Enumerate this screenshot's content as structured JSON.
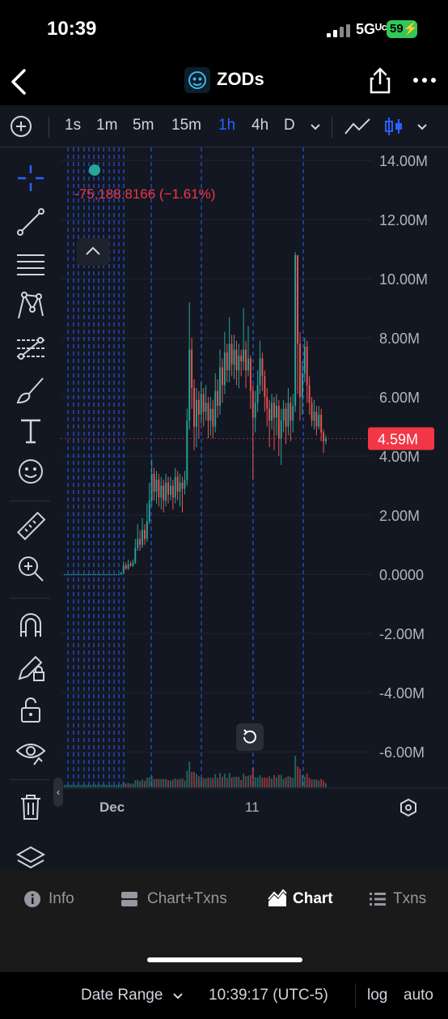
{
  "status": {
    "time": "10:39",
    "network": "5Gᵁᶜ",
    "battery": "59"
  },
  "header": {
    "token_name": "ZODs"
  },
  "toolbar": {
    "timeframes": [
      "1s",
      "1m",
      "5m",
      "15m",
      "1h",
      "4h",
      "D"
    ],
    "active_timeframe": "1h"
  },
  "chart": {
    "pnl_label": "-75,188.8166 (−1.61%)",
    "current_price_label": "4.59M",
    "y_ticks": [
      "14.00M",
      "12.00M",
      "10.00M",
      "8.00M",
      "6.00M",
      "4.00M",
      "2.00M",
      "0.0000",
      "-2.00M",
      "-4.00M",
      "-6.00M"
    ],
    "x_labels": [
      "Dec",
      "11"
    ]
  },
  "bottom_bar": {
    "date_range": "Date Range",
    "time": "10:39:17 (UTC-5)",
    "log": "log",
    "auto": "auto"
  },
  "tabs": [
    {
      "label": "Info",
      "icon": "info-icon"
    },
    {
      "label": "Chart+Txns",
      "icon": "chart-txns-icon"
    },
    {
      "label": "Chart",
      "icon": "chart-icon"
    },
    {
      "label": "Txns",
      "icon": "list-icon"
    }
  ],
  "active_tab": "Chart",
  "colors": {
    "up": "#26a69a",
    "down": "#ef5350",
    "accent": "#2962ff",
    "price_badge": "#f23645"
  },
  "chart_data": {
    "type": "candlestick",
    "y_axis_range": [
      -7200000,
      14000000
    ],
    "candles": [
      [
        0,
        0,
        10000,
        -10000
      ],
      [
        0,
        0,
        10000,
        -10000
      ],
      [
        0,
        0,
        10000,
        -10000
      ],
      [
        0,
        0,
        10000,
        -10000
      ],
      [
        0,
        0,
        10000,
        -10000
      ],
      [
        0,
        0,
        10000,
        -10000
      ],
      [
        0,
        0,
        10000,
        -10000
      ],
      [
        0,
        0,
        10000,
        -10000
      ],
      [
        0,
        0,
        10000,
        -10000
      ],
      [
        0,
        0,
        10000,
        -10000
      ],
      [
        0,
        0,
        10000,
        -10000
      ],
      [
        0,
        0,
        10000,
        -10000
      ],
      [
        0,
        0,
        10000,
        -10000
      ],
      [
        0,
        0,
        10000,
        -10000
      ],
      [
        0,
        0,
        10000,
        -10000
      ],
      [
        0,
        0,
        10000,
        -10000
      ],
      [
        0,
        0,
        10000,
        -10000
      ],
      [
        0,
        0,
        10000,
        -10000
      ],
      [
        0,
        0,
        10000,
        -10000
      ],
      [
        0,
        0,
        10000,
        -10000
      ],
      [
        0,
        0,
        10000,
        -10000
      ],
      [
        0,
        0,
        10000,
        -10000
      ],
      [
        0,
        0,
        10000,
        -10000
      ],
      [
        0,
        0,
        10000,
        -10000
      ],
      [
        0,
        50000,
        80000,
        -20000
      ],
      [
        50000,
        300000,
        450000,
        0
      ],
      [
        300000,
        200000,
        400000,
        150000
      ],
      [
        200000,
        350000,
        500000,
        150000
      ],
      [
        350000,
        300000,
        450000,
        250000
      ],
      [
        300000,
        400000,
        500000,
        250000
      ],
      [
        400000,
        900000,
        1200000,
        350000
      ],
      [
        900000,
        1200000,
        1700000,
        800000
      ],
      [
        1200000,
        1000000,
        1500000,
        800000
      ],
      [
        1000000,
        1500000,
        1900000,
        900000
      ],
      [
        1500000,
        1200000,
        1700000,
        1000000
      ],
      [
        1200000,
        1800000,
        2400000,
        1100000
      ],
      [
        1800000,
        2500000,
        3100000,
        1700000
      ],
      [
        2500000,
        3400000,
        3900000,
        2300000
      ],
      [
        3400000,
        2800000,
        3600000,
        2500000
      ],
      [
        2800000,
        3200000,
        3500000,
        2400000
      ],
      [
        3200000,
        2600000,
        3400000,
        2300000
      ],
      [
        2600000,
        3000000,
        3300000,
        2200000
      ],
      [
        3000000,
        2500000,
        3200000,
        2100000
      ],
      [
        2500000,
        3100000,
        3400000,
        2300000
      ],
      [
        3100000,
        2700000,
        3300000,
        2400000
      ],
      [
        2700000,
        3000000,
        3300000,
        2500000
      ],
      [
        3000000,
        2600000,
        3200000,
        2200000
      ],
      [
        2600000,
        3300000,
        3600000,
        2400000
      ],
      [
        3300000,
        2800000,
        3500000,
        2500000
      ],
      [
        2800000,
        3100000,
        3400000,
        2300000
      ],
      [
        3100000,
        2900000,
        3300000,
        2100000
      ],
      [
        2900000,
        3200000,
        3500000,
        2700000
      ],
      [
        3200000,
        5200000,
        5600000,
        3000000
      ],
      [
        5200000,
        7600000,
        9200000,
        4900000
      ],
      [
        7600000,
        6300000,
        8000000,
        5600000
      ],
      [
        6300000,
        5000000,
        6600000,
        4200000
      ],
      [
        5000000,
        5900000,
        6300000,
        4300000
      ],
      [
        5900000,
        5400000,
        6200000,
        4600000
      ],
      [
        5400000,
        6100000,
        6500000,
        5100000
      ],
      [
        6100000,
        5500000,
        6300000,
        5000000
      ],
      [
        5500000,
        5800000,
        6400000,
        5200000
      ],
      [
        5800000,
        5200000,
        6000000,
        4600000
      ],
      [
        5200000,
        5600000,
        6000000,
        4700000
      ],
      [
        5600000,
        5000000,
        5900000,
        4600000
      ],
      [
        5000000,
        6200000,
        6800000,
        4800000
      ],
      [
        6200000,
        5700000,
        6600000,
        5300000
      ],
      [
        5700000,
        7000000,
        7600000,
        5400000
      ],
      [
        7000000,
        6400000,
        7300000,
        5800000
      ],
      [
        6400000,
        7500000,
        8200000,
        6100000
      ],
      [
        7500000,
        6900000,
        7800000,
        6500000
      ],
      [
        6900000,
        7800000,
        8700000,
        6500000
      ],
      [
        7800000,
        7100000,
        8100000,
        6700000
      ],
      [
        7100000,
        7600000,
        8100000,
        6600000
      ],
      [
        7600000,
        6900000,
        7900000,
        6400000
      ],
      [
        6900000,
        7400000,
        7800000,
        6300000
      ],
      [
        7400000,
        7200000,
        7600000,
        6700000
      ],
      [
        7200000,
        7600000,
        9000000,
        6900000
      ],
      [
        7600000,
        6900000,
        7900000,
        6300000
      ],
      [
        6900000,
        7300000,
        8400000,
        6700000
      ],
      [
        7300000,
        6200000,
        7400000,
        5600000
      ],
      [
        6200000,
        5300000,
        6400000,
        3200000
      ],
      [
        5300000,
        5800000,
        6200000,
        4800000
      ],
      [
        5800000,
        6400000,
        6900000,
        5500000
      ],
      [
        6400000,
        7300000,
        7900000,
        6100000
      ],
      [
        7300000,
        6700000,
        7500000,
        6200000
      ],
      [
        6700000,
        6000000,
        6900000,
        5500000
      ],
      [
        6000000,
        5600000,
        6300000,
        5000000
      ],
      [
        5600000,
        5200000,
        5900000,
        4300000
      ],
      [
        5200000,
        5800000,
        6100000,
        4900000
      ],
      [
        5800000,
        5300000,
        6000000,
        4200000
      ],
      [
        5300000,
        5700000,
        6100000,
        4700000
      ],
      [
        5700000,
        4600000,
        5900000,
        4000000
      ],
      [
        4600000,
        5200000,
        5600000,
        3700000
      ],
      [
        5200000,
        5600000,
        5900000,
        4800000
      ],
      [
        5600000,
        5000000,
        5800000,
        4400000
      ],
      [
        5000000,
        5800000,
        6300000,
        4700000
      ],
      [
        5800000,
        5200000,
        6000000,
        4500000
      ],
      [
        5200000,
        5700000,
        6100000,
        4800000
      ],
      [
        5700000,
        10800000,
        10900000,
        5500000
      ],
      [
        10800000,
        7800000,
        9500000,
        6100000
      ],
      [
        7800000,
        6000000,
        8200000,
        5200000
      ],
      [
        6000000,
        6800000,
        7200000,
        5400000
      ],
      [
        6800000,
        7700000,
        8000000,
        6500000
      ],
      [
        7700000,
        6400000,
        7900000,
        5800000
      ],
      [
        6400000,
        5800000,
        6700000,
        5400000
      ],
      [
        5800000,
        5200000,
        6000000,
        5000000
      ],
      [
        5200000,
        5500000,
        5900000,
        4900000
      ],
      [
        5500000,
        5000000,
        5700000,
        4700000
      ],
      [
        5000000,
        5400000,
        5700000,
        4900000
      ],
      [
        5400000,
        4800000,
        5600000,
        4500000
      ],
      [
        4800000,
        4500000,
        4900000,
        4100000
      ],
      [
        4500000,
        4590000,
        4700000,
        4400000
      ]
    ]
  }
}
